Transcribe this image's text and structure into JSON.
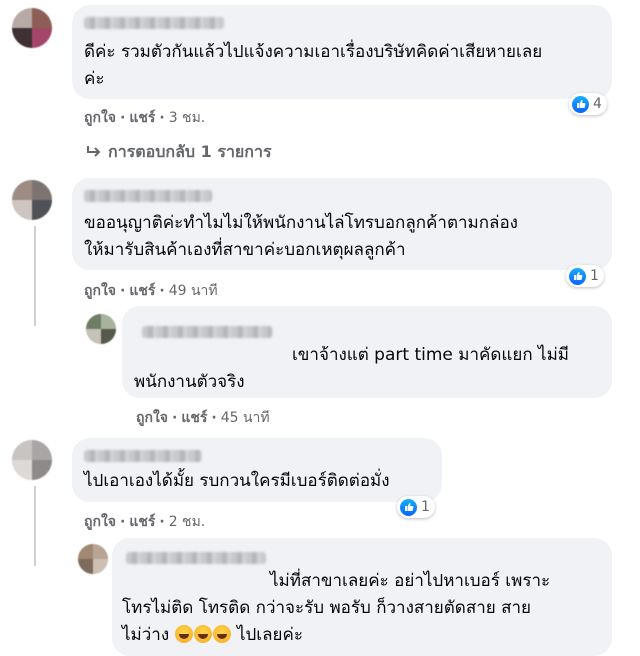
{
  "comments": [
    {
      "text_lines": [
        "ดีค่ะ รวมตัวกันแล้วไปแจ้งความเอาเรื่องบริษัทคิดค่าเสียหายเลย",
        "ค่ะ"
      ],
      "like_label": "ถูกใจ",
      "share_label": "แชร์",
      "time": "3 ชม.",
      "reaction_count": "4",
      "replies_link": "การตอบกลับ 1 รายการ"
    },
    {
      "text_lines": [
        "ขออนุญาติค่ะทำไมไม่ให้พนักงานไล่โทรบอกลูกค้าตามกล่อง",
        "ให้มารับสินค้าเองที่สาขาค่ะบอกเหตุผลลูกค้า"
      ],
      "like_label": "ถูกใจ",
      "share_label": "แชร์",
      "time": "49 นาที",
      "reaction_count": "1"
    },
    {
      "text_lines": [
        "เขาจ้างแต่ part time มาคัดแยก ไม่มี",
        "พนักงานตัวจริง"
      ],
      "like_label": "ถูกใจ",
      "share_label": "แชร์",
      "time": "45 นาที"
    },
    {
      "text_lines": [
        "ไปเอาเองได้มั้ย รบกวนใครมีเบอร์ติดต่อมั่ง"
      ],
      "like_label": "ถูกใจ",
      "share_label": "แชร์",
      "time": "2 ชม.",
      "reaction_count": "1"
    },
    {
      "text_lines": [
        "ไม่ที่สาขาเลยค่ะ อย่าไปหาเบอร์ เพราะ",
        "โทรไม่ติด โทรติด กว่าจะรับ พอรับ ก็วางสายตัดสาย สาย",
        "ไม่ว่าง",
        "ไปเลยค่ะ"
      ]
    }
  ],
  "colors": {
    "bubble": "#f0f2f5",
    "meta": "#65676b",
    "like_blue": "#0866ff"
  },
  "icons": {
    "reply_arrow": "reply-arrow-icon",
    "like": "like-icon",
    "emoji": "laughing-emoji-icon"
  }
}
